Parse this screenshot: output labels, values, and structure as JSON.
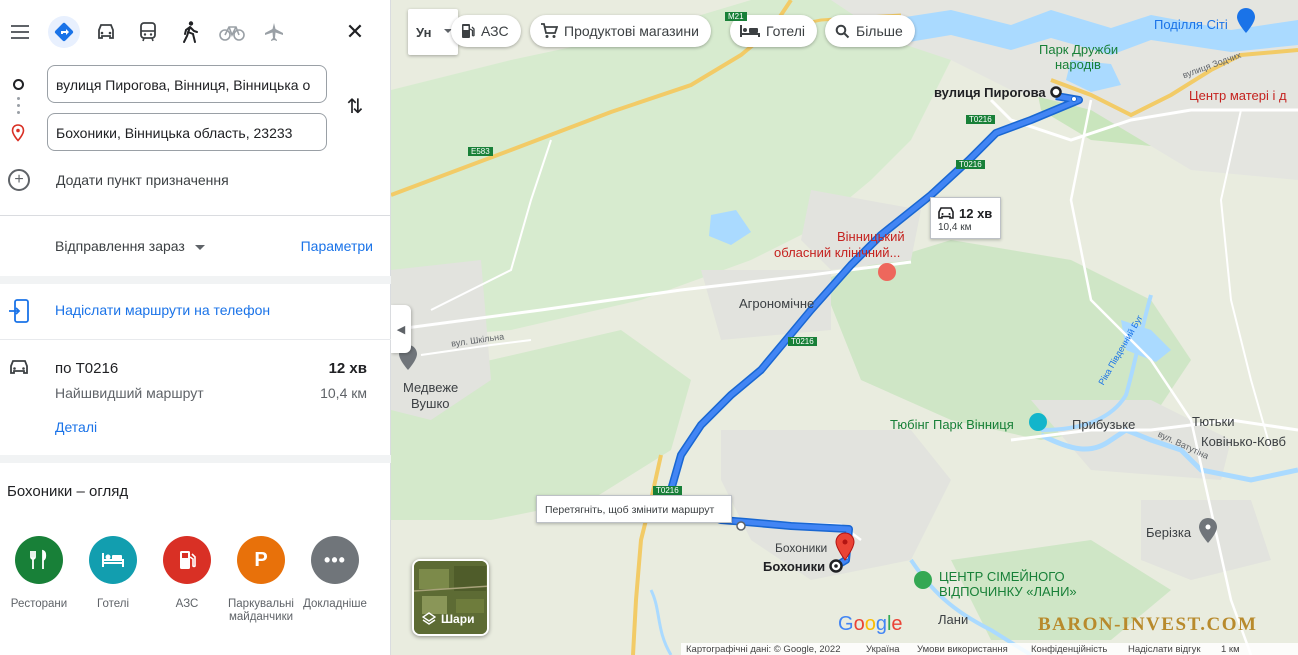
{
  "sidebar": {
    "origin": "вулиця Пирогова, Вінниця, Вінницька о",
    "destination": "Бохоники, Вінницька область, 23233",
    "add_destination": "Додати пункт призначення",
    "depart": "Відправлення зараз",
    "options": "Параметри",
    "send_to_phone": "Надіслати маршрути на телефон",
    "route": {
      "name": "по T0216",
      "time": "12 хв",
      "subtitle": "Найшвидший маршрут",
      "distance": "10,4 км",
      "details": "Деталі"
    },
    "overview_title": "Бохоники – огляд",
    "poi": [
      {
        "label": "Ресторани",
        "color": "#188038",
        "icon": "restaurant-icon"
      },
      {
        "label": "Готелі",
        "color": "#129eaf",
        "icon": "hotel-icon"
      },
      {
        "label": "АЗС",
        "color": "#d93025",
        "icon": "gas-station-icon"
      },
      {
        "label": "Паркувальні майданчики",
        "color": "#e8710a",
        "icon": "parking-icon"
      },
      {
        "label": "Докладніше",
        "color": "#70757a",
        "icon": "more-icon"
      }
    ]
  },
  "map": {
    "input_tool": "Ун",
    "chips": [
      "АЗС",
      "Продуктові магазини",
      "Готелі",
      "Більше"
    ],
    "badge_time": "12 хв",
    "badge_distance": "10,4 км",
    "drag_tip": "Перетягніть, щоб змінити маршрут",
    "layers": "Шари",
    "labels": {
      "start": "вулиця Пирогова",
      "end": "Бохоники",
      "end2": "Бохоники",
      "park": "Парк Дружби",
      "park2": "народів",
      "podillia": "Поділля Сіті",
      "center_mother": "Центр матері і д",
      "hospital1": "Вінницький",
      "hospital2": "обласний клінічний...",
      "agro": "Агрономічне",
      "medv1": "Медвеже",
      "medv2": "Вушко",
      "tubing": "Тюбінг Парк Вінниця",
      "prybuzke": "Прибузьке",
      "tiutky": "Тютьки",
      "kovynko": "Ковінько-Ковб",
      "berizka": "Берізка",
      "lany": "Лани",
      "family1": "ЦЕНТР СІМЕЙНОГО",
      "family2": "ВІДПОЧИНКУ «ЛАНИ»",
      "vul_shkilna": "вул. Шкільна",
      "vul_vatutina": "вул. Ватутіна",
      "vul_zodchykh": "вулиця Зодчих",
      "river": "Ріка Південний Буг"
    },
    "shields": {
      "t0216": "T0216",
      "e583": "E583",
      "m21": "M21"
    },
    "footer": {
      "data": "Картографічні дані: © Google, 2022",
      "country": "Україна",
      "terms": "Умови використання",
      "privacy": "Конфіденційність",
      "feedback": "Надіслати відгук",
      "scale": "1 км"
    },
    "google": "Google",
    "watermark": "BARON-INVEST.COM",
    "colors": {
      "route": "#4285f4",
      "route_border": "#1967d2",
      "water": "#aadaff",
      "green": "#cde8c4"
    }
  }
}
